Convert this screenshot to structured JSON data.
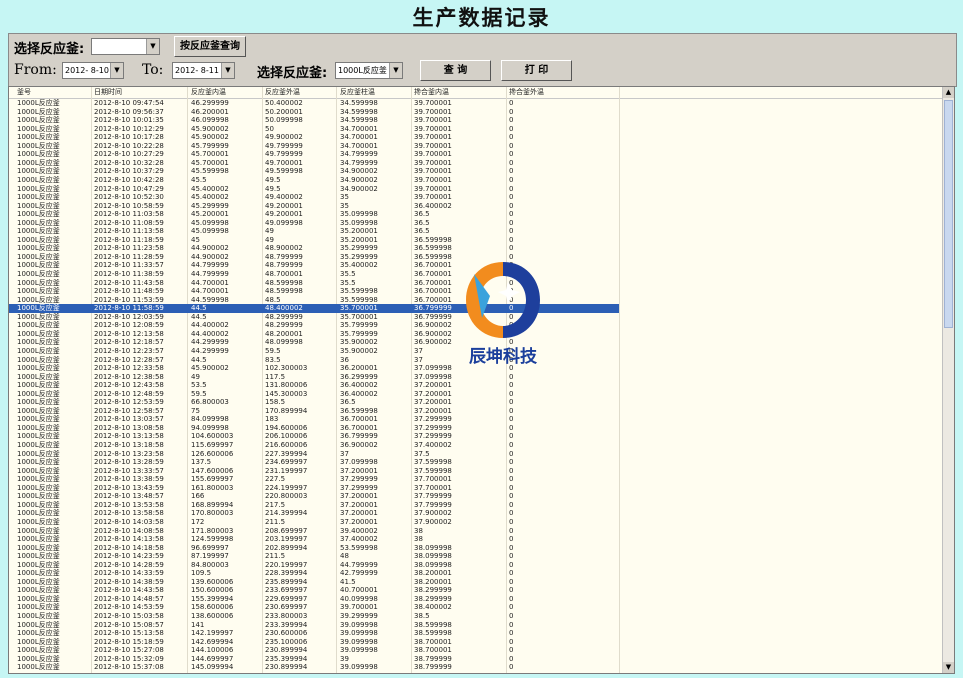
{
  "title": "生产数据记录",
  "toolbar": {
    "select_reactor_label": "选择反应釜:",
    "reactor_combo_value": "",
    "query_by_reactor_button": "按反应釜查询",
    "from_label": "From:",
    "from_value": "2012- 8-10",
    "to_label": "To:",
    "to_value": "2012- 8-11",
    "select_reactor_label2": "选择反应釜:",
    "reactor_combo2_value": "1000L反应釜",
    "query_button": "查 询",
    "print_button": "打 印"
  },
  "table": {
    "columns": [
      "釜号",
      "日期时间",
      "反应釜内温",
      "反应釜外温",
      "反应釜柱温",
      "搀合釜内温",
      "搀合釜外温"
    ],
    "selected_row": 24,
    "rows": [
      [
        "1000L反应釜",
        "2012-8-10 09:47:54",
        "46.299999",
        "50.400002",
        "34.599998",
        "39.700001",
        "0"
      ],
      [
        "1000L反应釜",
        "2012-8-10 09:56:37",
        "46.200001",
        "50.200001",
        "34.599998",
        "39.700001",
        "0"
      ],
      [
        "1000L反应釜",
        "2012-8-10 10:01:35",
        "46.099998",
        "50.099998",
        "34.599998",
        "39.700001",
        "0"
      ],
      [
        "1000L反应釜",
        "2012-8-10 10:12:29",
        "45.900002",
        "50",
        "34.700001",
        "39.700001",
        "0"
      ],
      [
        "1000L反应釜",
        "2012-8-10 10:17:28",
        "45.900002",
        "49.900002",
        "34.700001",
        "39.700001",
        "0"
      ],
      [
        "1000L反应釜",
        "2012-8-10 10:22:28",
        "45.799999",
        "49.799999",
        "34.700001",
        "39.700001",
        "0"
      ],
      [
        "1000L反应釜",
        "2012-8-10 10:27:29",
        "45.700001",
        "49.799999",
        "34.799999",
        "39.700001",
        "0"
      ],
      [
        "1000L反应釜",
        "2012-8-10 10:32:28",
        "45.700001",
        "49.700001",
        "34.799999",
        "39.700001",
        "0"
      ],
      [
        "1000L反应釜",
        "2012-8-10 10:37:29",
        "45.599998",
        "49.599998",
        "34.900002",
        "39.700001",
        "0"
      ],
      [
        "1000L反应釜",
        "2012-8-10 10:42:28",
        "45.5",
        "49.5",
        "34.900002",
        "39.700001",
        "0"
      ],
      [
        "1000L反应釜",
        "2012-8-10 10:47:29",
        "45.400002",
        "49.5",
        "34.900002",
        "39.700001",
        "0"
      ],
      [
        "1000L反应釜",
        "2012-8-10 10:52:30",
        "45.400002",
        "49.400002",
        "35",
        "39.700001",
        "0"
      ],
      [
        "1000L反应釜",
        "2012-8-10 10:58:59",
        "45.299999",
        "49.200001",
        "35",
        "36.400002",
        "0"
      ],
      [
        "1000L反应釜",
        "2012-8-10 11:03:58",
        "45.200001",
        "49.200001",
        "35.099998",
        "36.5",
        "0"
      ],
      [
        "1000L反应釜",
        "2012-8-10 11:08:59",
        "45.099998",
        "49.099998",
        "35.099998",
        "36.5",
        "0"
      ],
      [
        "1000L反应釜",
        "2012-8-10 11:13:58",
        "45.099998",
        "49",
        "35.200001",
        "36.5",
        "0"
      ],
      [
        "1000L反应釜",
        "2012-8-10 11:18:59",
        "45",
        "49",
        "35.200001",
        "36.599998",
        "0"
      ],
      [
        "1000L反应釜",
        "2012-8-10 11:23:58",
        "44.900002",
        "48.900002",
        "35.299999",
        "36.599998",
        "0"
      ],
      [
        "1000L反应釜",
        "2012-8-10 11:28:59",
        "44.900002",
        "48.799999",
        "35.299999",
        "36.599998",
        "0"
      ],
      [
        "1000L反应釜",
        "2012-8-10 11:33:57",
        "44.799999",
        "48.799999",
        "35.400002",
        "36.700001",
        "0"
      ],
      [
        "1000L反应釜",
        "2012-8-10 11:38:59",
        "44.799999",
        "48.700001",
        "35.5",
        "36.700001",
        "0"
      ],
      [
        "1000L反应釜",
        "2012-8-10 11:43:58",
        "44.700001",
        "48.599998",
        "35.5",
        "36.700001",
        "0"
      ],
      [
        "1000L反应釜",
        "2012-8-10 11:48:59",
        "44.700001",
        "48.599998",
        "35.599998",
        "36.700001",
        "0"
      ],
      [
        "1000L反应釜",
        "2012-8-10 11:53:59",
        "44.599998",
        "48.5",
        "35.599998",
        "36.700001",
        "0"
      ],
      [
        "1000L反应釜",
        "2012-8-10 11:58:59",
        "44.5",
        "48.400002",
        "35.700001",
        "36.799999",
        "0"
      ],
      [
        "1000L反应釜",
        "2012-8-10 12:03:59",
        "44.5",
        "48.299999",
        "35.700001",
        "36.799999",
        "0"
      ],
      [
        "1000L反应釜",
        "2012-8-10 12:08:59",
        "44.400002",
        "48.299999",
        "35.799999",
        "36.900002",
        "0"
      ],
      [
        "1000L反应釜",
        "2012-8-10 12:13:58",
        "44.400002",
        "48.200001",
        "35.799999",
        "36.900002",
        "0"
      ],
      [
        "1000L反应釜",
        "2012-8-10 12:18:57",
        "44.299999",
        "48.099998",
        "35.900002",
        "36.900002",
        "0"
      ],
      [
        "1000L反应釜",
        "2012-8-10 12:23:57",
        "44.299999",
        "59.5",
        "35.900002",
        "37",
        "0"
      ],
      [
        "1000L反应釜",
        "2012-8-10 12:28:57",
        "44.5",
        "83.5",
        "36",
        "37",
        "0"
      ],
      [
        "1000L反应釜",
        "2012-8-10 12:33:58",
        "45.900002",
        "102.300003",
        "36.200001",
        "37.099998",
        "0"
      ],
      [
        "1000L反应釜",
        "2012-8-10 12:38:58",
        "49",
        "117.5",
        "36.299999",
        "37.099998",
        "0"
      ],
      [
        "1000L反应釜",
        "2012-8-10 12:43:58",
        "53.5",
        "131.800006",
        "36.400002",
        "37.200001",
        "0"
      ],
      [
        "1000L反应釜",
        "2012-8-10 12:48:59",
        "59.5",
        "145.300003",
        "36.400002",
        "37.200001",
        "0"
      ],
      [
        "1000L反应釜",
        "2012-8-10 12:53:59",
        "66.800003",
        "158.5",
        "36.5",
        "37.200001",
        "0"
      ],
      [
        "1000L反应釜",
        "2012-8-10 12:58:57",
        "75",
        "170.899994",
        "36.599998",
        "37.200001",
        "0"
      ],
      [
        "1000L反应釜",
        "2012-8-10 13:03:57",
        "84.099998",
        "183",
        "36.700001",
        "37.299999",
        "0"
      ],
      [
        "1000L反应釜",
        "2012-8-10 13:08:58",
        "94.099998",
        "194.600006",
        "36.700001",
        "37.299999",
        "0"
      ],
      [
        "1000L反应釜",
        "2012-8-10 13:13:58",
        "104.600003",
        "206.100006",
        "36.799999",
        "37.299999",
        "0"
      ],
      [
        "1000L反应釜",
        "2012-8-10 13:18:58",
        "115.699997",
        "216.600006",
        "36.900002",
        "37.400002",
        "0"
      ],
      [
        "1000L反应釜",
        "2012-8-10 13:23:58",
        "126.600006",
        "227.399994",
        "37",
        "37.5",
        "0"
      ],
      [
        "1000L反应釜",
        "2012-8-10 13:28:59",
        "137.5",
        "234.699997",
        "37.099998",
        "37.599998",
        "0"
      ],
      [
        "1000L反应釜",
        "2012-8-10 13:33:57",
        "147.600006",
        "231.199997",
        "37.200001",
        "37.599998",
        "0"
      ],
      [
        "1000L反应釜",
        "2012-8-10 13:38:59",
        "155.699997",
        "227.5",
        "37.299999",
        "37.700001",
        "0"
      ],
      [
        "1000L反应釜",
        "2012-8-10 13:43:59",
        "161.800003",
        "224.199997",
        "37.299999",
        "37.700001",
        "0"
      ],
      [
        "1000L反应釜",
        "2012-8-10 13:48:57",
        "166",
        "220.800003",
        "37.200001",
        "37.799999",
        "0"
      ],
      [
        "1000L反应釜",
        "2012-8-10 13:53:58",
        "168.899994",
        "217.5",
        "37.200001",
        "37.799999",
        "0"
      ],
      [
        "1000L反应釜",
        "2012-8-10 13:58:58",
        "170.800003",
        "214.399994",
        "37.200001",
        "37.900002",
        "0"
      ],
      [
        "1000L反应釜",
        "2012-8-10 14:03:58",
        "172",
        "211.5",
        "37.200001",
        "37.900002",
        "0"
      ],
      [
        "1000L反应釜",
        "2012-8-10 14:08:58",
        "171.800003",
        "208.699997",
        "39.400002",
        "38",
        "0"
      ],
      [
        "1000L反应釜",
        "2012-8-10 14:13:58",
        "124.599998",
        "203.199997",
        "37.400002",
        "38",
        "0"
      ],
      [
        "1000L反应釜",
        "2012-8-10 14:18:58",
        "96.699997",
        "202.899994",
        "53.599998",
        "38.099998",
        "0"
      ],
      [
        "1000L反应釜",
        "2012-8-10 14:23:59",
        "87.199997",
        "211.5",
        "48",
        "38.099998",
        "0"
      ],
      [
        "1000L反应釜",
        "2012-8-10 14:28:59",
        "84.800003",
        "220.199997",
        "44.799999",
        "38.099998",
        "0"
      ],
      [
        "1000L反应釜",
        "2012-8-10 14:33:59",
        "109.5",
        "228.399994",
        "42.799999",
        "38.200001",
        "0"
      ],
      [
        "1000L反应釜",
        "2012-8-10 14:38:59",
        "139.600006",
        "235.899994",
        "41.5",
        "38.200001",
        "0"
      ],
      [
        "1000L反应釜",
        "2012-8-10 14:43:58",
        "150.600006",
        "233.699997",
        "40.700001",
        "38.299999",
        "0"
      ],
      [
        "1000L反应釜",
        "2012-8-10 14:48:57",
        "155.399994",
        "229.699997",
        "40.099998",
        "38.299999",
        "0"
      ],
      [
        "1000L反应釜",
        "2012-8-10 14:53:59",
        "158.600006",
        "230.699997",
        "39.700001",
        "38.400002",
        "0"
      ],
      [
        "1000L反应釜",
        "2012-8-10 15:03:58",
        "138.600006",
        "233.800003",
        "39.299999",
        "38.5",
        "0"
      ],
      [
        "1000L反应釜",
        "2012-8-10 15:08:57",
        "141",
        "233.399994",
        "39.099998",
        "38.599998",
        "0"
      ],
      [
        "1000L反应釜",
        "2012-8-10 15:13:58",
        "142.199997",
        "230.600006",
        "39.099998",
        "38.599998",
        "0"
      ],
      [
        "1000L反应釜",
        "2012-8-10 15:18:59",
        "142.699994",
        "235.100006",
        "39.099998",
        "38.700001",
        "0"
      ],
      [
        "1000L反应釜",
        "2012-8-10 15:27:08",
        "144.100006",
        "230.899994",
        "39.099998",
        "38.700001",
        "0"
      ],
      [
        "1000L反应釜",
        "2012-8-10 15:32:09",
        "144.699997",
        "235.399994",
        "39",
        "38.799999",
        "0"
      ],
      [
        "1000L反应釜",
        "2012-8-10 15:37:08",
        "145.099994",
        "230.899994",
        "39.099998",
        "38.799999",
        "0"
      ]
    ]
  },
  "watermark": {
    "text": "辰坤科技"
  }
}
